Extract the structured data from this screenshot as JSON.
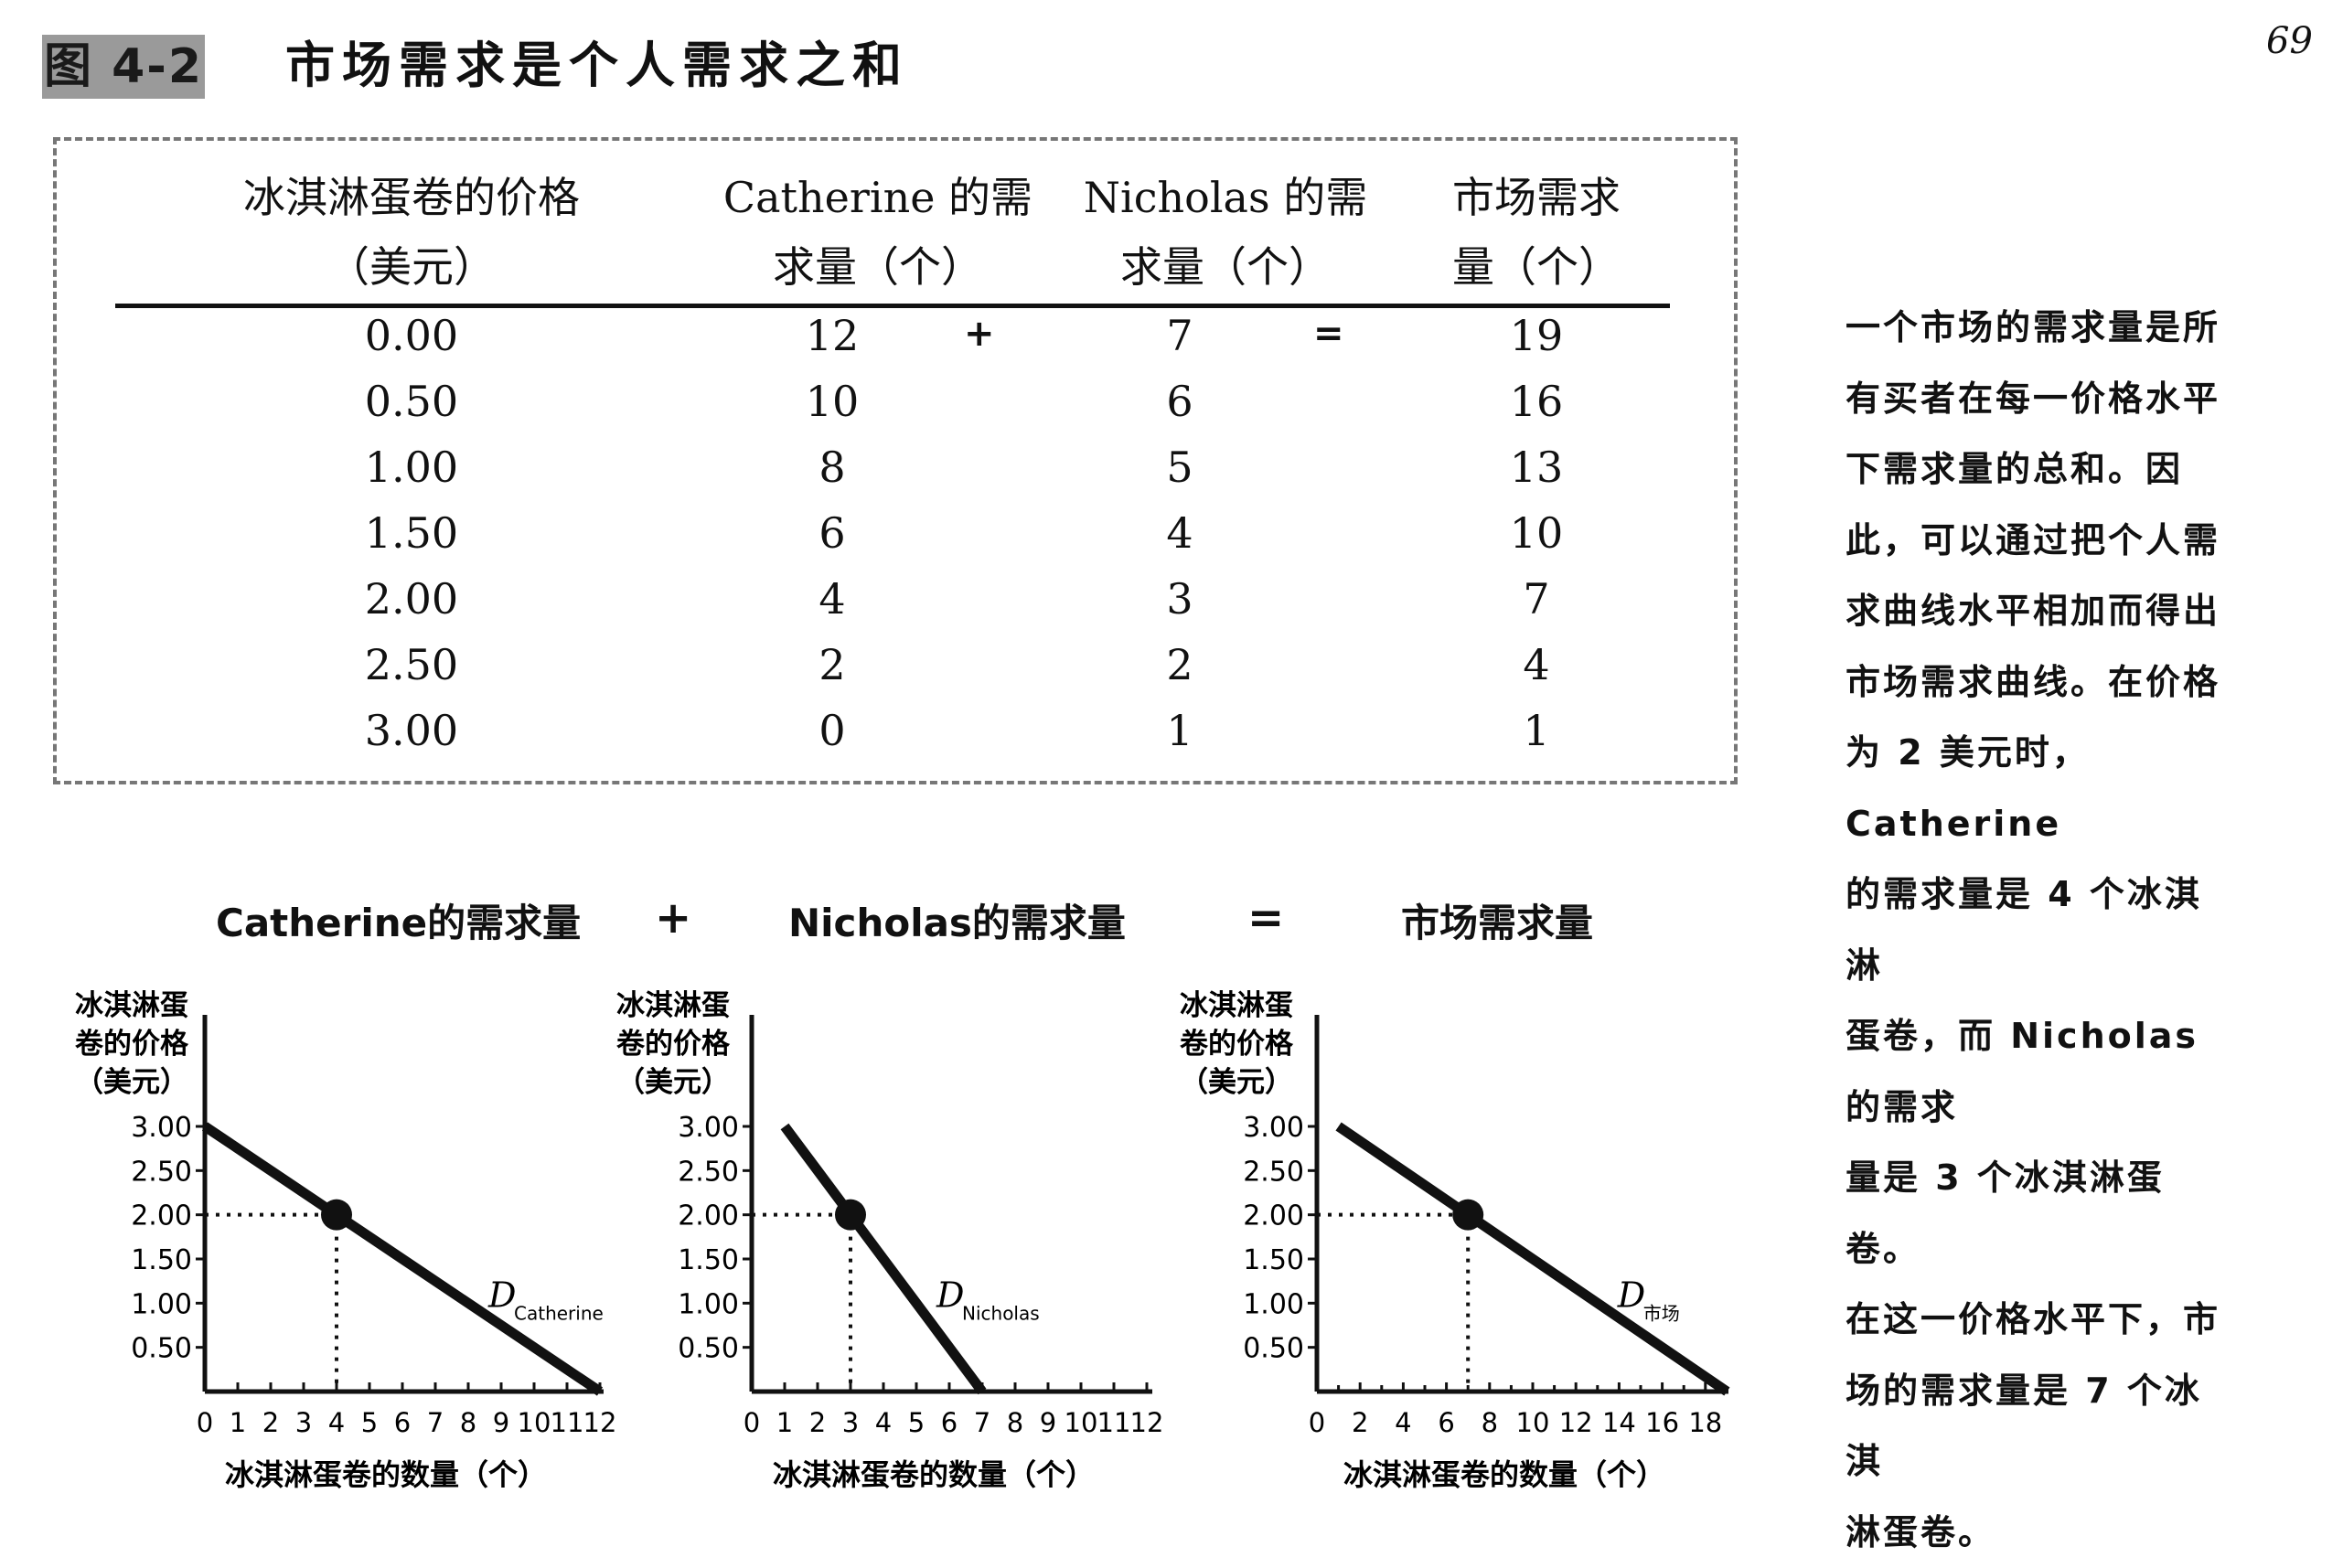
{
  "figure": {
    "label": "图 4-2",
    "title": "市场需求是个人需求之和",
    "page_number": "69"
  },
  "table": {
    "headers": [
      {
        "line1": "冰淇淋蛋卷的价格",
        "line2": "（美元）"
      },
      {
        "line1": "Catherine 的需",
        "line2": "求量（个）"
      },
      {
        "line1": "Nicholas 的需",
        "line2": "求量（个）"
      },
      {
        "line1": "市场需求",
        "line2": "量（个）"
      }
    ],
    "plus_sign": "+",
    "equals_sign": "=",
    "rows": [
      [
        "0.00",
        "12",
        "7",
        "19"
      ],
      [
        "0.50",
        "10",
        "6",
        "16"
      ],
      [
        "1.00",
        "8",
        "5",
        "13"
      ],
      [
        "1.50",
        "6",
        "4",
        "10"
      ],
      [
        "2.00",
        "4",
        "3",
        "7"
      ],
      [
        "2.50",
        "2",
        "2",
        "4"
      ],
      [
        "3.00",
        "0",
        "1",
        "1"
      ]
    ]
  },
  "side_text": [
    "一个市场的需求量是所",
    "有买者在每一价格水平",
    "下需求量的总和。因",
    "此，可以通过把个人需",
    "求曲线水平相加而得出",
    "市场需求曲线。在价格",
    "为 2 美元时，Catherine",
    "的需求量是 4 个冰淇淋",
    "蛋卷，而 Nicholas 的需求",
    "量是 3 个冰淇淋蛋卷。",
    "在这一价格水平下，市",
    "场的需求量是 7 个冰淇",
    "淋蛋卷。"
  ],
  "graph_headings": {
    "left": "Catherine的需求量",
    "plus": "+",
    "middle": "Nicholas的需求量",
    "equals": "=",
    "right": "市场需求量"
  },
  "chart_data": [
    {
      "type": "line",
      "title": "Catherine的需求量",
      "ylabel": "冰淇淋蛋卷的价格（美元）",
      "ylabel_lines": [
        "冰淇淋蛋",
        "卷的价格",
        "（美元）"
      ],
      "xlabel": "冰淇淋蛋卷的数量（个）",
      "xlim": [
        0,
        12
      ],
      "ylim": [
        0,
        3
      ],
      "x_ticks": [
        "0",
        "1",
        "2",
        "3",
        "4",
        "5",
        "6",
        "7",
        "8",
        "9",
        "10",
        "11",
        "12"
      ],
      "y_ticks": [
        "0.50",
        "1.00",
        "1.50",
        "2.00",
        "2.50",
        "3.00"
      ],
      "series": [
        {
          "name": "Catherine",
          "x": [
            0,
            2,
            4,
            6,
            8,
            10,
            12
          ],
          "y": [
            3.0,
            2.5,
            2.0,
            1.5,
            1.0,
            0.5,
            0.0
          ]
        }
      ],
      "curve_label": "D",
      "curve_label_sub": "Catherine",
      "highlight": {
        "x": 4,
        "y": 2.0
      }
    },
    {
      "type": "line",
      "title": "Nicholas的需求量",
      "ylabel": "冰淇淋蛋卷的价格（美元）",
      "ylabel_lines": [
        "冰淇淋蛋",
        "卷的价格",
        "（美元）"
      ],
      "xlabel": "冰淇淋蛋卷的数量（个）",
      "xlim": [
        0,
        12
      ],
      "ylim": [
        0,
        3
      ],
      "x_ticks": [
        "0",
        "1",
        "2",
        "3",
        "4",
        "5",
        "6",
        "7",
        "8",
        "9",
        "10",
        "11",
        "12"
      ],
      "y_ticks": [
        "0.50",
        "1.00",
        "1.50",
        "2.00",
        "2.50",
        "3.00"
      ],
      "series": [
        {
          "name": "Nicholas",
          "x": [
            1,
            2,
            3,
            4,
            5,
            6,
            7
          ],
          "y": [
            3.0,
            2.5,
            2.0,
            1.5,
            1.0,
            0.5,
            0.0
          ]
        }
      ],
      "curve_label": "D",
      "curve_label_sub": "Nicholas",
      "highlight": {
        "x": 3,
        "y": 2.0
      }
    },
    {
      "type": "line",
      "title": "市场需求量",
      "ylabel": "冰淇淋蛋卷的价格（美元）",
      "ylabel_lines": [
        "冰淇淋蛋",
        "卷的价格",
        "（美元）"
      ],
      "xlabel": "冰淇淋蛋卷的数量（个）",
      "xlim": [
        0,
        19
      ],
      "ylim": [
        0,
        3
      ],
      "x_ticks": [
        "0",
        "2",
        "4",
        "6",
        "8",
        "10",
        "12",
        "14",
        "16",
        "18"
      ],
      "y_ticks": [
        "0.50",
        "1.00",
        "1.50",
        "2.00",
        "2.50",
        "3.00"
      ],
      "series": [
        {
          "name": "市场",
          "x": [
            1,
            4,
            7,
            10,
            13,
            16,
            19
          ],
          "y": [
            3.0,
            2.5,
            2.0,
            1.5,
            1.0,
            0.5,
            0.0
          ]
        }
      ],
      "curve_label": "D",
      "curve_label_sub": "市场",
      "highlight": {
        "x": 7,
        "y": 2.0
      }
    }
  ]
}
